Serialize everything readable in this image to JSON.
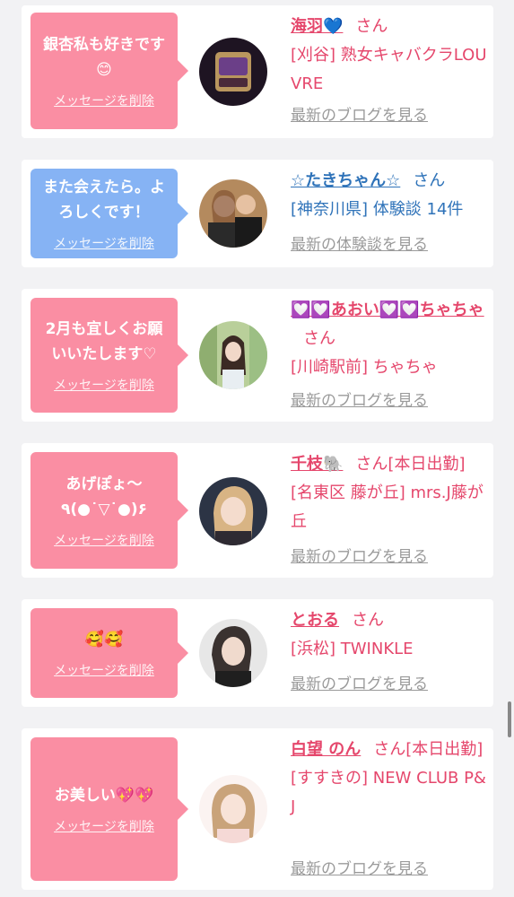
{
  "colors": {
    "pink": "#fa8ea3",
    "blue": "#86b3f4",
    "pink_text": "#e5476c",
    "blue_text": "#2f73b9",
    "gray_link": "#9a9a9a"
  },
  "cards": [
    {
      "bubble_color": "pink",
      "message": "銀杏私も好きです😊",
      "delete_label": "メッセージを削除",
      "name": "海羽💙",
      "suffix": "さん",
      "shop": "[刈谷] 熟女キャバクラLOUVRE",
      "link": "最新のブログを見る"
    },
    {
      "bubble_color": "blue",
      "message": "また会えたら。よろしくです！",
      "delete_label": "メッセージを削除",
      "name": "☆たきちゃん☆",
      "suffix": "さん",
      "shop": "[神奈川県] 体験談 14件",
      "link": "最新の体験談を見る"
    },
    {
      "bubble_color": "pink",
      "message": "2月も宜しくお願いいたします♡",
      "delete_label": "メッセージを削除",
      "name": "💟💟あおい💟💟ちゃちゃ",
      "suffix": "さん",
      "shop": "[川崎駅前] ちゃちゃ",
      "link": "最新のブログを見る"
    },
    {
      "bubble_color": "pink",
      "message": "あげぽょ〜\n٩(●˙▽˙●)۶",
      "delete_label": "メッセージを削除",
      "name": "千枝🐘",
      "suffix": "さん[本日出勤]",
      "shop": "[名東区 藤が丘] mrs.J藤が丘",
      "link": "最新のブログを見る"
    },
    {
      "bubble_color": "pink",
      "message": "🥰🥰",
      "delete_label": "メッセージを削除",
      "name": "とおる",
      "suffix": "さん",
      "shop": "[浜松] TWINKLE",
      "link": "最新のブログを見る"
    },
    {
      "bubble_color": "pink",
      "message": "お美しい💖💖",
      "delete_label": "メッセージを削除",
      "name": "白望 のん",
      "suffix": "さん[本日出勤]",
      "shop": "[すすきの] NEW CLUB P&J",
      "link": "最新のブログを見る"
    }
  ]
}
